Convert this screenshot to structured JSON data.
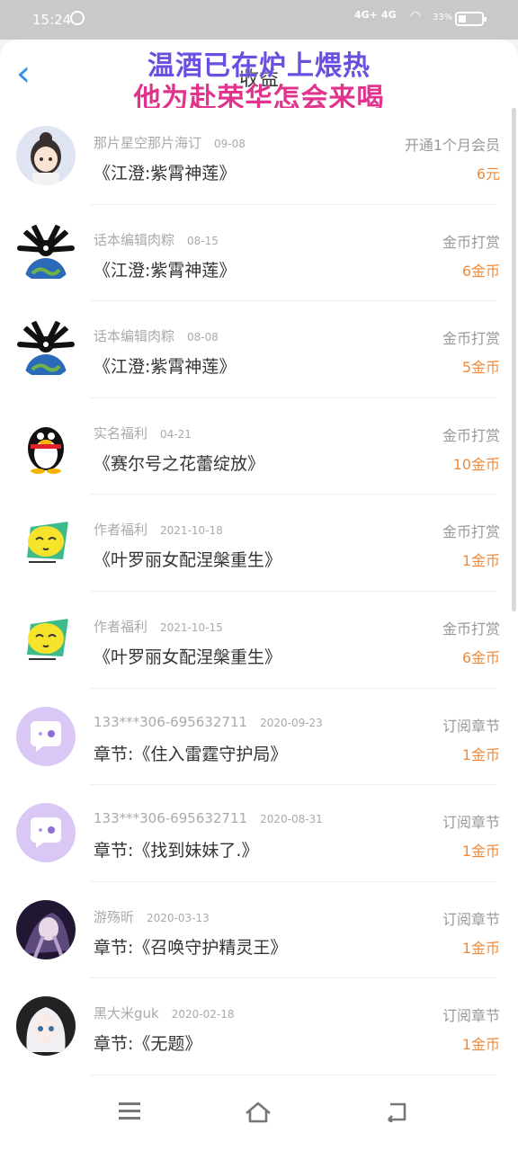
{
  "status": {
    "time": "15:24",
    "net1": "4G+",
    "net2": "4G",
    "battery_pct": "33%",
    "alarm_glyph": "⏰"
  },
  "header": {
    "back_glyph": "‹",
    "title": "收益",
    "overlay_line1": "温酒已在炉上煨热",
    "overlay_line2": "他为赴荣华怎会来喝"
  },
  "records": [
    {
      "avatar": "girl-avatar",
      "name": "那片星空那片海订",
      "date": "09-08",
      "book": "《江澄:紫霄神莲》",
      "type": "开通1个月会员",
      "amount": "6元"
    },
    {
      "avatar": "earth-avatar",
      "name": "话本编辑肉粽",
      "date": "08-15",
      "book": "《江澄:紫霄神莲》",
      "type": "金币打赏",
      "amount": "6金币"
    },
    {
      "avatar": "earth-avatar",
      "name": "话本编辑肉粽",
      "date": "08-08",
      "book": "《江澄:紫霄神莲》",
      "type": "金币打赏",
      "amount": "5金币"
    },
    {
      "avatar": "penguin-avatar",
      "name": "实名福利",
      "date": "04-21",
      "book": "《赛尔号之花蕾绽放》",
      "type": "金币打赏",
      "amount": "10金币"
    },
    {
      "avatar": "emoji-avatar",
      "name": "作者福利",
      "date": "2021-10-18",
      "book": "《叶罗丽女配涅槃重生》",
      "type": "金币打赏",
      "amount": "1金币"
    },
    {
      "avatar": "emoji-avatar",
      "name": "作者福利",
      "date": "2021-10-15",
      "book": "《叶罗丽女配涅槃重生》",
      "type": "金币打赏",
      "amount": "6金币"
    },
    {
      "avatar": "chat-avatar",
      "name": "133***306-695632711",
      "date": "2020-09-23",
      "book": "章节:《住入雷霆守护局》",
      "type": "订阅章节",
      "amount": "1金币"
    },
    {
      "avatar": "chat-avatar",
      "name": "133***306-695632711",
      "date": "2020-08-31",
      "book": "章节:《找到妹妹了.》",
      "type": "订阅章节",
      "amount": "1金币"
    },
    {
      "avatar": "anime-avatar",
      "name": "游殇昕",
      "date": "2020-03-13",
      "book": "章节:《召唤守护精灵王》",
      "type": "订阅章节",
      "amount": "1金币"
    },
    {
      "avatar": "white-hair-avatar",
      "name": "黑大米guk",
      "date": "2020-02-18",
      "book": "章节:《无题》",
      "type": "订阅章节",
      "amount": "1金币"
    }
  ],
  "colors": {
    "accent": "#2d8ff0",
    "amount": "#f08a3a",
    "overlay1": "#6b4fe0",
    "overlay2": "#e0348c"
  }
}
